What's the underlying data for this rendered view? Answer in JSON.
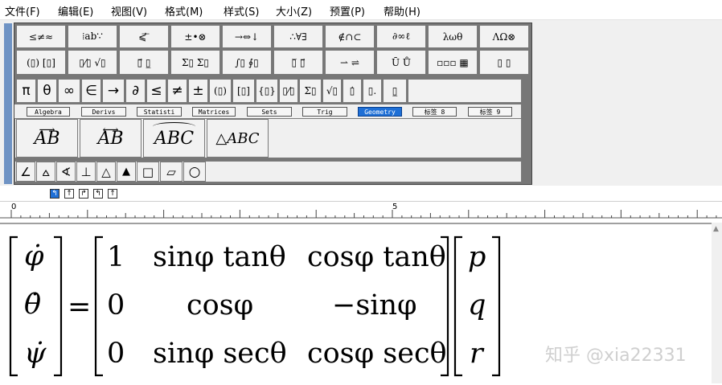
{
  "menu": [
    "文件(F)",
    "编辑(E)",
    "视图(V)",
    "格式(M)",
    "样式(S)",
    "大小(Z)",
    "预置(P)",
    "帮助(H)"
  ],
  "palette_row1": [
    "≤≠≈",
    "⁞ab∵",
    "⩽⃗ ⃖",
    "±•⊗",
    "→⇔↓",
    "∴∀∃",
    "∉∩⊂",
    "∂∞ℓ",
    "λωθ",
    "ΛΩ⊗"
  ],
  "palette_row2": [
    "(▯) [▯]",
    "▯⁄▯ √▯",
    "▯⃗ ▯̲",
    "Σ▯ Σ▯",
    "∫▯ ∮▯",
    "▯̅ ▯⃗",
    "⇀ ⇌",
    "Ū Ů",
    "▫▫▫ ▦",
    "▯ ▯"
  ],
  "palette_row3": [
    "π",
    "θ",
    "∞",
    "∈",
    "→",
    "∂",
    "≤",
    "≠",
    "±",
    "(▯)",
    "[▯]",
    "{▯}",
    "▯⁄▯",
    "Σ▯",
    "√▯",
    "▯̇",
    "▯.",
    "▯̲"
  ],
  "tabs": [
    "Algebra",
    "Derivs",
    "Statisti",
    "Matrices",
    "Sets",
    "Trig",
    "Geometry",
    "标签 8",
    "标签 9"
  ],
  "active_tab": "Geometry",
  "geometry_templates": [
    "AB",
    "AB",
    "ABC",
    "△ABC"
  ],
  "geometry_symbols": [
    "∠",
    "⩟",
    "∢",
    "⊥",
    "△",
    "▲",
    "□",
    "▱",
    "○"
  ],
  "nudge": [
    "↰",
    "↑",
    "↱",
    "↰",
    "↑"
  ],
  "ruler": {
    "mark0": "0",
    "mark5": "5"
  },
  "equation": {
    "lhs": [
      "φ̇",
      "θ̇",
      "ψ̇"
    ],
    "equals": "=",
    "matrix": [
      [
        "1",
        "sinφ tanθ",
        "cosφ tanθ"
      ],
      [
        "0",
        "cosφ",
        "−sinφ"
      ],
      [
        "0",
        "sinφ secθ",
        "cosφ secθ"
      ]
    ],
    "rhs": [
      "p",
      "q",
      "r"
    ]
  },
  "watermark": "知乎 @xia22331"
}
